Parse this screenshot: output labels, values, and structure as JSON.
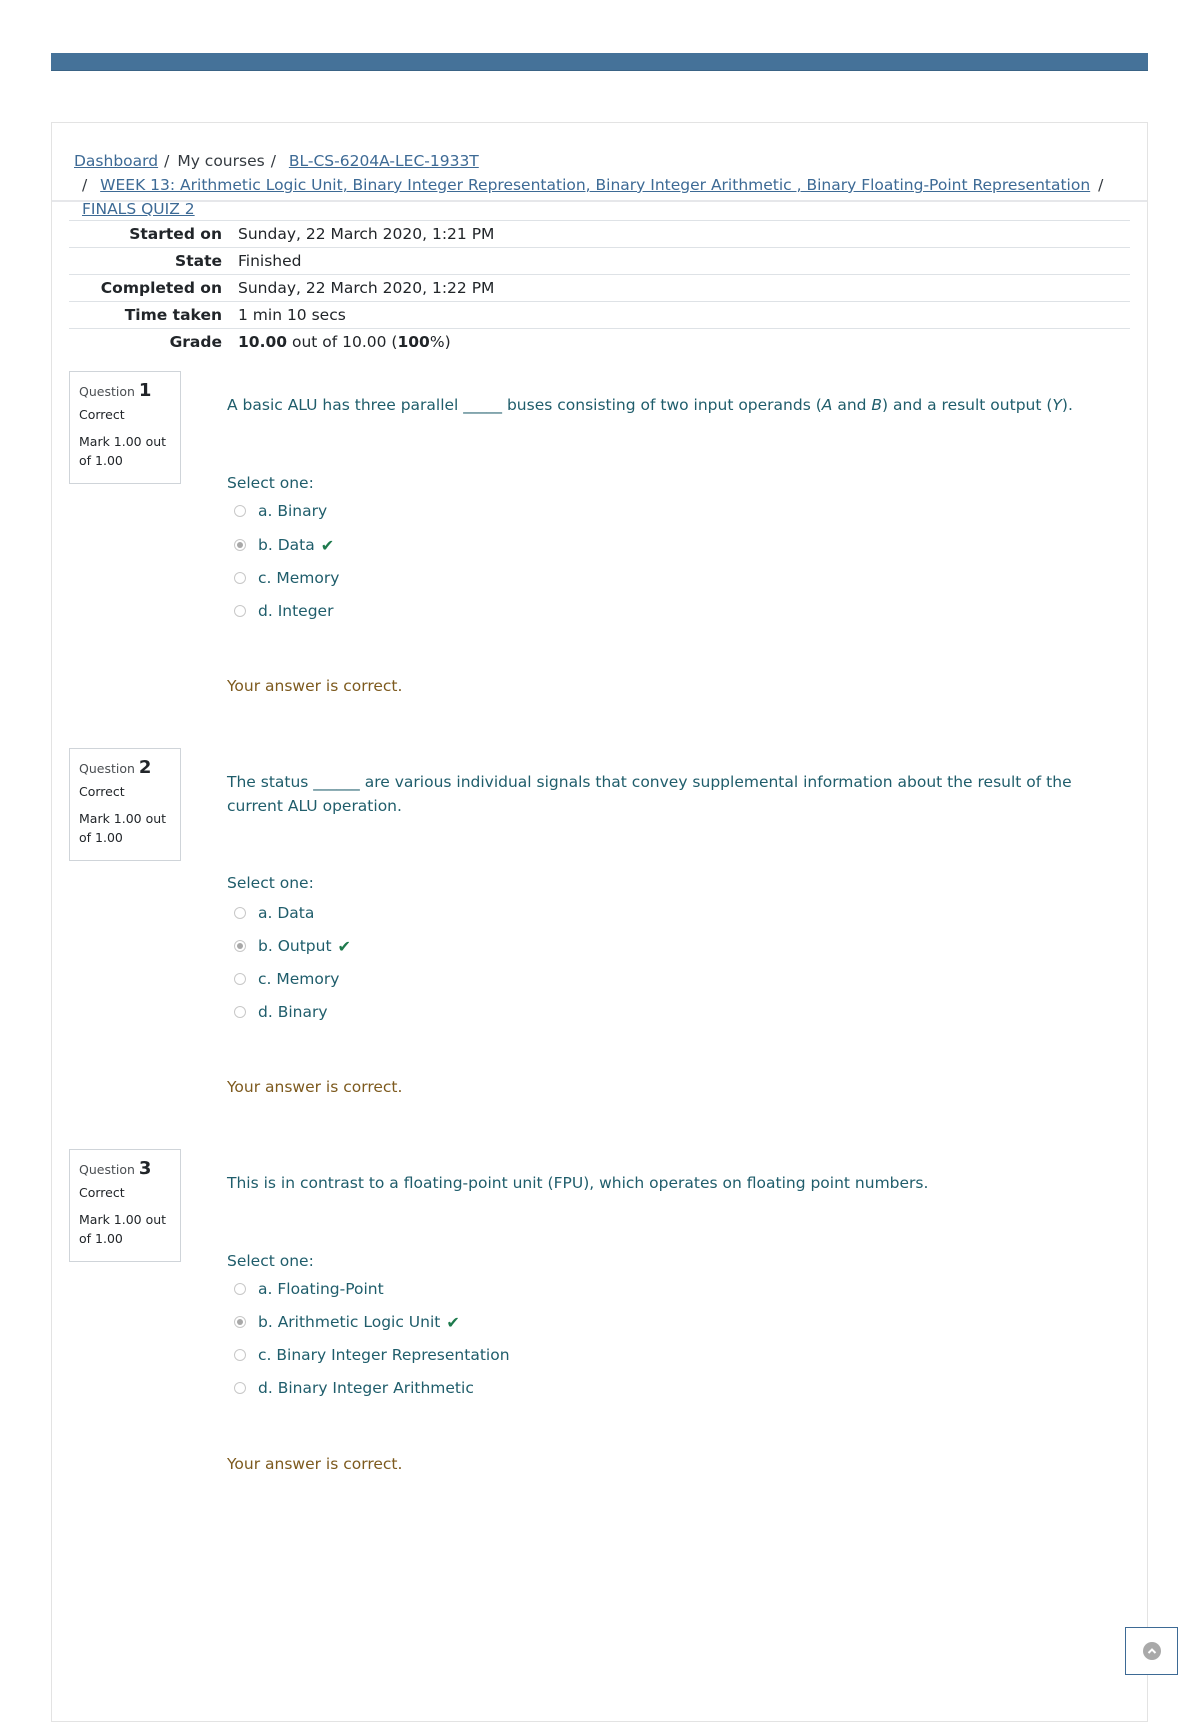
{
  "breadcrumb": {
    "items": [
      {
        "label": "Dashboard",
        "link": true
      },
      {
        "label": "My courses",
        "link": false
      },
      {
        "label": "BL-CS-6204A-LEC-1933T",
        "link": true
      },
      {
        "label": "WEEK 13: Arithmetic Logic Unit, Binary Integer Representation, Binary Integer Arithmetic , Binary Floating-Point Representation",
        "link": true
      },
      {
        "label": "FINALS QUIZ 2",
        "link": true
      }
    ],
    "separator": "/"
  },
  "summary": {
    "rows": [
      {
        "label": "Started on",
        "value": "Sunday, 22 March 2020, 1:21 PM"
      },
      {
        "label": "State",
        "value": "Finished"
      },
      {
        "label": "Completed on",
        "value": "Sunday, 22 March 2020, 1:22 PM"
      },
      {
        "label": "Time taken",
        "value": "1 min 10 secs"
      }
    ],
    "grade": {
      "label": "Grade",
      "score": "10.00",
      "out_of_text": " out of 10.00 (",
      "percent": "100",
      "suffix": "%)"
    }
  },
  "questions": [
    {
      "word": "Question",
      "number": "1",
      "state": "Correct",
      "mark": "Mark 1.00 out of 1.00",
      "text_parts": [
        "A basic ALU has three parallel _____ buses consisting of two input operands (",
        "A",
        " and ",
        "B",
        ") and a result output (",
        "Y",
        ")."
      ],
      "prompt": "Select one:",
      "options": [
        {
          "label": "a. Binary",
          "selected": false,
          "correct": false
        },
        {
          "label": "b. Data",
          "selected": true,
          "correct": true
        },
        {
          "label": "c. Memory",
          "selected": false,
          "correct": false
        },
        {
          "label": "d. Integer",
          "selected": false,
          "correct": false
        }
      ],
      "feedback": "Your answer is correct."
    },
    {
      "word": "Question",
      "number": "2",
      "state": "Correct",
      "mark": "Mark 1.00 out of 1.00",
      "text": "The status ______ are various individual signals that convey supplemental information about the result of the current ALU operation.",
      "prompt": "Select one:",
      "options": [
        {
          "label": "a. Data",
          "selected": false,
          "correct": false
        },
        {
          "label": "b. Output",
          "selected": true,
          "correct": true
        },
        {
          "label": "c. Memory",
          "selected": false,
          "correct": false
        },
        {
          "label": "d. Binary",
          "selected": false,
          "correct": false
        }
      ],
      "feedback": "Your answer is correct."
    },
    {
      "word": "Question",
      "number": "3",
      "state": "Correct",
      "mark": "Mark 1.00 out of 1.00",
      "text": "This is in contrast to a floating-point unit (FPU), which operates on floating point numbers.",
      "prompt": "Select one:",
      "options": [
        {
          "label": "a. Floating-Point",
          "selected": false,
          "correct": false
        },
        {
          "label": "b. Arithmetic Logic Unit",
          "selected": true,
          "correct": true
        },
        {
          "label": "c. Binary Integer Representation",
          "selected": false,
          "correct": false
        },
        {
          "label": "d. Binary Integer Arithmetic",
          "selected": false,
          "correct": false
        }
      ],
      "feedback": "Your answer is correct."
    }
  ],
  "icons": {
    "correct": "check-icon",
    "back_to_top": "chevron-up-circle-icon"
  },
  "colors": {
    "brand_bar": "#457299",
    "link": "#3d6a95",
    "question_text": "#1f5d6b",
    "feedback": "#7d5a1e",
    "correct_check": "#1e7a4d"
  }
}
